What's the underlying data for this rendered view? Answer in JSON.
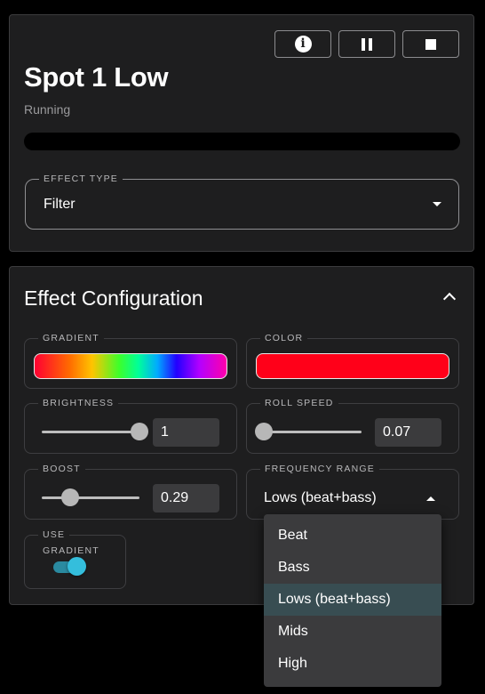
{
  "header": {
    "title": "Spot 1 Low",
    "status": "Running",
    "progress_percent": 0
  },
  "toolbar": {
    "info_icon": "info-icon",
    "pause_icon": "pause-icon",
    "stop_icon": "stop-icon"
  },
  "effect_type": {
    "label": "EFFECT TYPE",
    "value": "Filter"
  },
  "config": {
    "title": "Effect Configuration",
    "gradient": {
      "label": "GRADIENT"
    },
    "color": {
      "label": "COLOR",
      "value": "#ff0019"
    },
    "brightness": {
      "label": "BRIGHTNESS",
      "value": "1",
      "fraction": 1.0
    },
    "roll_speed": {
      "label": "ROLL SPEED",
      "value": "0.07",
      "fraction": 0.0
    },
    "boost": {
      "label": "BOOST",
      "value": "0.29",
      "fraction": 0.29
    },
    "frequency_range": {
      "label": "FREQUENCY RANGE",
      "value": "Lows (beat+bass)",
      "options": [
        "Beat",
        "Bass",
        "Lows (beat+bass)",
        "Mids",
        "High"
      ],
      "selected_index": 2
    },
    "use": {
      "label": "USE",
      "sub_label": "GRADIENT",
      "enabled": true
    }
  },
  "colors": {
    "card_bg": "#1e1e1f",
    "accent": "#34bedc",
    "menu_bg": "#3b3b3d",
    "menu_selected": "#384d52"
  }
}
